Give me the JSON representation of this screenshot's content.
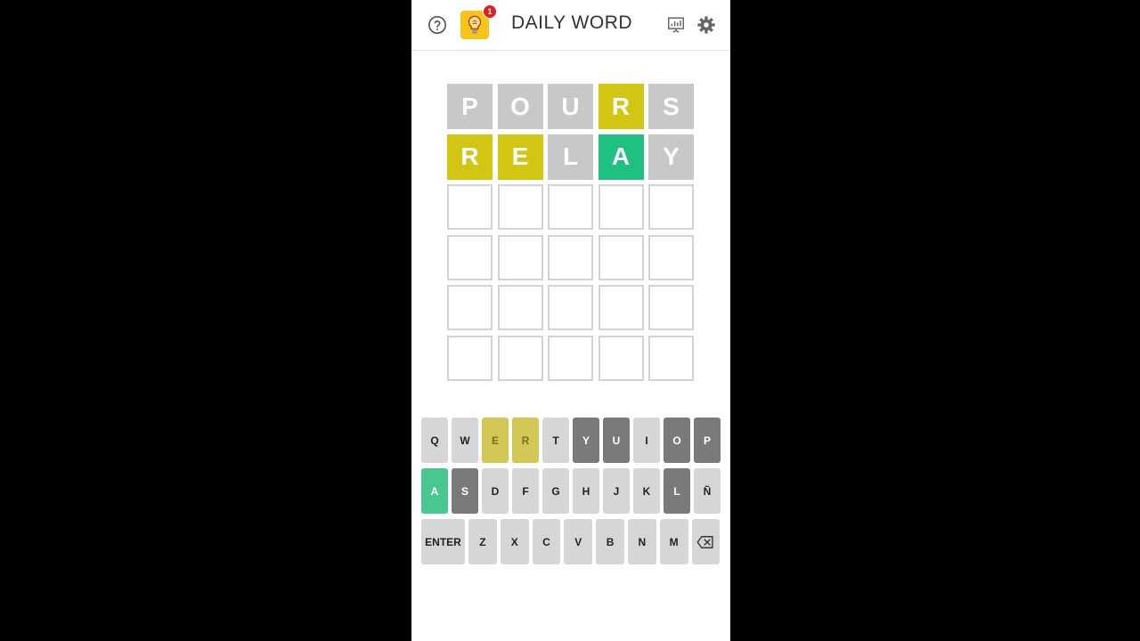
{
  "header": {
    "title": "DAILY WORD",
    "badge_count": "1",
    "icons": [
      "help-icon",
      "lightbulb-icon",
      "stats-icon",
      "gear-icon"
    ]
  },
  "board": {
    "rows": [
      [
        {
          "letter": "P",
          "state": "absent"
        },
        {
          "letter": "O",
          "state": "absent"
        },
        {
          "letter": "U",
          "state": "absent"
        },
        {
          "letter": "R",
          "state": "present"
        },
        {
          "letter": "S",
          "state": "absent"
        }
      ],
      [
        {
          "letter": "R",
          "state": "present"
        },
        {
          "letter": "E",
          "state": "present"
        },
        {
          "letter": "L",
          "state": "absent"
        },
        {
          "letter": "A",
          "state": "correct"
        },
        {
          "letter": "Y",
          "state": "absent"
        }
      ],
      [
        {
          "letter": "",
          "state": "empty"
        },
        {
          "letter": "",
          "state": "empty"
        },
        {
          "letter": "",
          "state": "empty"
        },
        {
          "letter": "",
          "state": "empty"
        },
        {
          "letter": "",
          "state": "empty"
        }
      ],
      [
        {
          "letter": "",
          "state": "empty"
        },
        {
          "letter": "",
          "state": "empty"
        },
        {
          "letter": "",
          "state": "empty"
        },
        {
          "letter": "",
          "state": "empty"
        },
        {
          "letter": "",
          "state": "empty"
        }
      ],
      [
        {
          "letter": "",
          "state": "empty"
        },
        {
          "letter": "",
          "state": "empty"
        },
        {
          "letter": "",
          "state": "empty"
        },
        {
          "letter": "",
          "state": "empty"
        },
        {
          "letter": "",
          "state": "empty"
        }
      ],
      [
        {
          "letter": "",
          "state": "empty"
        },
        {
          "letter": "",
          "state": "empty"
        },
        {
          "letter": "",
          "state": "empty"
        },
        {
          "letter": "",
          "state": "empty"
        },
        {
          "letter": "",
          "state": "empty"
        }
      ]
    ]
  },
  "keyboard": {
    "rows": [
      [
        {
          "label": "Q",
          "state": "unused"
        },
        {
          "label": "W",
          "state": "unused"
        },
        {
          "label": "E",
          "state": "present"
        },
        {
          "label": "R",
          "state": "present"
        },
        {
          "label": "T",
          "state": "unused"
        },
        {
          "label": "Y",
          "state": "absent"
        },
        {
          "label": "U",
          "state": "absent"
        },
        {
          "label": "I",
          "state": "unused"
        },
        {
          "label": "O",
          "state": "absent"
        },
        {
          "label": "P",
          "state": "absent"
        }
      ],
      [
        {
          "label": "A",
          "state": "correct"
        },
        {
          "label": "S",
          "state": "absent"
        },
        {
          "label": "D",
          "state": "unused"
        },
        {
          "label": "F",
          "state": "unused"
        },
        {
          "label": "G",
          "state": "unused"
        },
        {
          "label": "H",
          "state": "unused"
        },
        {
          "label": "J",
          "state": "unused"
        },
        {
          "label": "K",
          "state": "unused"
        },
        {
          "label": "L",
          "state": "absent"
        },
        {
          "label": "Ñ",
          "state": "unused"
        }
      ],
      [
        {
          "label": "ENTER",
          "state": "unused",
          "wide": true
        },
        {
          "label": "Z",
          "state": "unused"
        },
        {
          "label": "X",
          "state": "unused"
        },
        {
          "label": "C",
          "state": "unused"
        },
        {
          "label": "V",
          "state": "unused"
        },
        {
          "label": "B",
          "state": "unused"
        },
        {
          "label": "N",
          "state": "unused"
        },
        {
          "label": "M",
          "state": "unused"
        },
        {
          "label": "",
          "state": "unused",
          "icon": "backspace-icon"
        }
      ]
    ]
  },
  "colors": {
    "correct": "#1ec17f",
    "present": "#d3c613",
    "absent": "#c8c8c8",
    "key_absent": "#7a7a7a"
  }
}
